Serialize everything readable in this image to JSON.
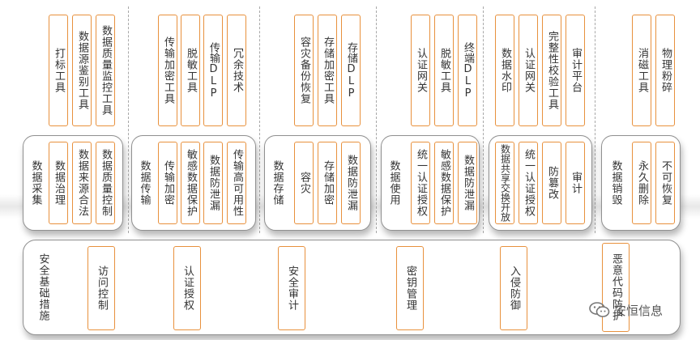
{
  "tools": [
    {
      "id": "tool-1",
      "text": "打标工具"
    },
    {
      "id": "tool-2",
      "text": "数据源鉴别工具"
    },
    {
      "id": "tool-3",
      "text": "数据质量监控工具"
    },
    {
      "id": "tool-4",
      "text": "传输加密工具"
    },
    {
      "id": "tool-5",
      "text": "脱敏工具"
    },
    {
      "id": "tool-6",
      "text": "传输DLP"
    },
    {
      "id": "tool-7",
      "text": "冗余技术"
    },
    {
      "id": "tool-8",
      "text": "容灾备份恢复"
    },
    {
      "id": "tool-9",
      "text": "存储加密工具"
    },
    {
      "id": "tool-10",
      "text": "存储DLP"
    },
    {
      "id": "tool-11",
      "text": "认证网关"
    },
    {
      "id": "tool-12",
      "text": "脱敏工具"
    },
    {
      "id": "tool-13",
      "text": "终端DLP"
    },
    {
      "id": "tool-14",
      "text": "数据水印"
    },
    {
      "id": "tool-15",
      "text": "认证网关"
    },
    {
      "id": "tool-16",
      "text": "完整性校验工具"
    },
    {
      "id": "tool-17",
      "text": "审计平台"
    },
    {
      "id": "tool-18",
      "text": "消磁工具"
    },
    {
      "id": "tool-19",
      "text": "物理粉碎"
    }
  ],
  "phases": [
    {
      "id": "collect",
      "label": "数据采集",
      "controls": [
        "数据治理",
        "数据来源合法",
        "数据质量控制"
      ]
    },
    {
      "id": "transfer",
      "label": "数据传输",
      "controls": [
        "传输加密",
        "敏感数据保护",
        "数据防泄漏",
        "传输高可用性"
      ]
    },
    {
      "id": "storage",
      "label": "数据存储",
      "controls": [
        "容灾",
        "存储加密",
        "数据防泄漏"
      ]
    },
    {
      "id": "usage",
      "label": "数据使用",
      "controls": [
        "统一认证授权",
        "敏感数据保护",
        "数据防泄漏"
      ]
    },
    {
      "id": "share",
      "label": "",
      "controls": [
        "数据共享交换开放",
        "统一认证授权",
        "防篡改",
        "审计"
      ]
    },
    {
      "id": "destroy",
      "label": "数据销毁",
      "controls": [
        "永久删除",
        "不可恢复"
      ]
    }
  ],
  "foundation": {
    "label": "安全基础措施",
    "items": [
      "访问控制",
      "认证授权",
      "安全审计",
      "密钥管理",
      "入侵防御",
      "恶意代码防护"
    ]
  },
  "watermark": {
    "text": "安恒信息",
    "icon": "wechat-icon"
  }
}
